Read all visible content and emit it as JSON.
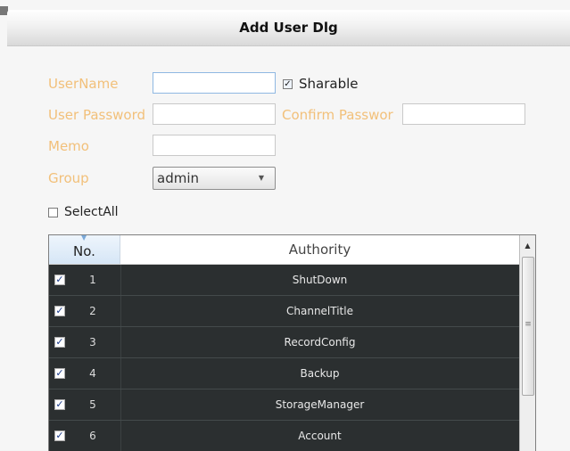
{
  "dialog": {
    "title": "Add User Dlg"
  },
  "form": {
    "username_label": "UserName",
    "username_value": "",
    "sharable_label": "Sharable",
    "sharable_checked": true,
    "password_label": "User Password",
    "password_value": "",
    "confirm_label": "Confirm Passwor",
    "confirm_value": "",
    "memo_label": "Memo",
    "memo_value": "",
    "group_label": "Group",
    "group_value": "admin",
    "select_all_label": "SelectAll",
    "select_all_checked": false
  },
  "table": {
    "columns": {
      "no": "No.",
      "authority": "Authority"
    },
    "rows": [
      {
        "checked": true,
        "no": "1",
        "authority": "ShutDown"
      },
      {
        "checked": true,
        "no": "2",
        "authority": "ChannelTitle"
      },
      {
        "checked": true,
        "no": "3",
        "authority": "RecordConfig"
      },
      {
        "checked": true,
        "no": "4",
        "authority": "Backup"
      },
      {
        "checked": true,
        "no": "5",
        "authority": "StorageManager"
      },
      {
        "checked": true,
        "no": "6",
        "authority": "Account"
      }
    ]
  },
  "icons": {
    "check": "check-icon",
    "dropdown": "chevron-down-icon",
    "scroll_up": "scroll-up-icon",
    "sort": "sort-caret-icon"
  },
  "colors": {
    "label_text": "#f2c07a",
    "grid_background": "#2b2f30",
    "header_selected": "#d6e6f6"
  }
}
